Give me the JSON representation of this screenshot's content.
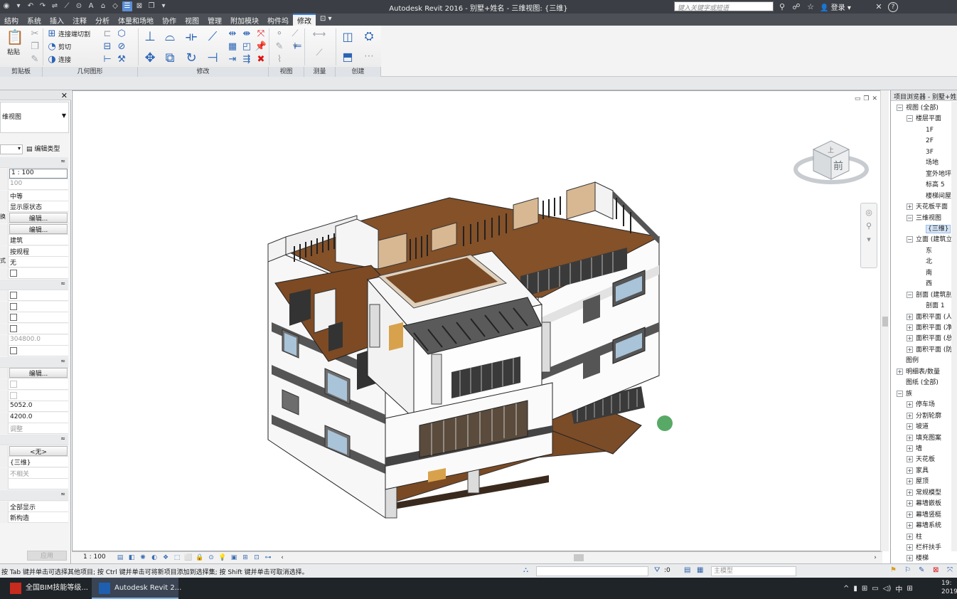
{
  "app": {
    "title": "Autodesk Revit 2016 -     别墅+姓名 - 三维视图: {三维}",
    "search_placeholder": "键入关键字或短语",
    "login": "登录",
    "help": "?"
  },
  "tabs": [
    "结构",
    "系统",
    "插入",
    "注释",
    "分析",
    "体量和场地",
    "协作",
    "视图",
    "管理",
    "附加模块",
    "构件坞",
    "修改"
  ],
  "ribbon": {
    "paste": "粘贴",
    "connect_cut": "连接端切割",
    "cut": "剪切",
    "join": "连接",
    "panels": [
      "剪贴板",
      "几何图形",
      "修改",
      "视图",
      "测量",
      "创建"
    ]
  },
  "properties": {
    "type_name": "维视图",
    "edit_type": "编辑类型",
    "rows": [
      {
        "kind": "section",
        "v": "≈"
      },
      {
        "kind": "boxed",
        "v": "1 : 100"
      },
      {
        "kind": "text",
        "v": "100",
        "dim": true
      },
      {
        "kind": "text",
        "v": "中等"
      },
      {
        "kind": "text",
        "v": "显示原状态"
      },
      {
        "kind": "btn",
        "l": "换",
        "v": "编辑..."
      },
      {
        "kind": "btn",
        "v": "编辑..."
      },
      {
        "kind": "text",
        "v": "建筑"
      },
      {
        "kind": "text",
        "v": "按规程"
      },
      {
        "kind": "text",
        "l": "式",
        "v": "无"
      },
      {
        "kind": "cb"
      },
      {
        "kind": "section",
        "v": "≈"
      },
      {
        "kind": "cb"
      },
      {
        "kind": "cb"
      },
      {
        "kind": "cb"
      },
      {
        "kind": "cb"
      },
      {
        "kind": "text",
        "v": "304800.0",
        "dim": true
      },
      {
        "kind": "cb"
      },
      {
        "kind": "section",
        "v": "≈"
      },
      {
        "kind": "btn",
        "v": "编辑..."
      },
      {
        "kind": "cb",
        "dim": true
      },
      {
        "kind": "cb",
        "dim": true
      },
      {
        "kind": "text",
        "v": "5052.0"
      },
      {
        "kind": "text",
        "v": "4200.0"
      },
      {
        "kind": "text",
        "v": "调整",
        "dim": true
      },
      {
        "kind": "section",
        "v": "≈"
      },
      {
        "kind": "btn",
        "v": "<无>"
      },
      {
        "kind": "text",
        "v": "{三维}"
      },
      {
        "kind": "text",
        "v": "不相关",
        "dim": true
      },
      {
        "kind": "text",
        "v": ""
      },
      {
        "kind": "section",
        "v": "≈"
      },
      {
        "kind": "text",
        "v": "全部显示"
      },
      {
        "kind": "text",
        "v": "新构造"
      }
    ],
    "apply": "应用"
  },
  "viewcube": {
    "face": "前",
    "top": "上"
  },
  "viewbar": {
    "scale": "1 : 100"
  },
  "browser": {
    "title": "项目浏览器 - 别墅+姓",
    "items": [
      {
        "d": 0,
        "t": "视图 (全部)",
        "tg": "−"
      },
      {
        "d": 1,
        "t": "楼层平面",
        "tg": "−"
      },
      {
        "d": 2,
        "t": "1F"
      },
      {
        "d": 2,
        "t": "2F"
      },
      {
        "d": 2,
        "t": "3F"
      },
      {
        "d": 2,
        "t": "场地"
      },
      {
        "d": 2,
        "t": "室外地坪"
      },
      {
        "d": 2,
        "t": "标高 5"
      },
      {
        "d": 2,
        "t": "楼梯间屋顶"
      },
      {
        "d": 1,
        "t": "天花板平面",
        "tg": "+"
      },
      {
        "d": 1,
        "t": "三维视图",
        "tg": "−"
      },
      {
        "d": 2,
        "t": "{三维}",
        "sel": true
      },
      {
        "d": 1,
        "t": "立面 (建筑立面)",
        "tg": "−"
      },
      {
        "d": 2,
        "t": "东"
      },
      {
        "d": 2,
        "t": "北"
      },
      {
        "d": 2,
        "t": "南"
      },
      {
        "d": 2,
        "t": "西"
      },
      {
        "d": 1,
        "t": "剖面 (建筑剖面)",
        "tg": "−"
      },
      {
        "d": 2,
        "t": "剖面 1"
      },
      {
        "d": 1,
        "t": "面积平面 (人防分区)",
        "tg": "+"
      },
      {
        "d": 1,
        "t": "面积平面 (净面积)",
        "tg": "+"
      },
      {
        "d": 1,
        "t": "面积平面 (总建筑面积)",
        "tg": "+"
      },
      {
        "d": 1,
        "t": "面积平面 (防火分区)",
        "tg": "+"
      },
      {
        "d": 0,
        "t": "图例"
      },
      {
        "d": 0,
        "t": "明细表/数量",
        "tg": "+"
      },
      {
        "d": 0,
        "t": "图纸 (全部)"
      },
      {
        "d": 0,
        "t": "族",
        "tg": "−"
      },
      {
        "d": 1,
        "t": "停车场",
        "tg": "+"
      },
      {
        "d": 1,
        "t": "分割轮廓",
        "tg": "+"
      },
      {
        "d": 1,
        "t": "坡道",
        "tg": "+"
      },
      {
        "d": 1,
        "t": "填充图案",
        "tg": "+"
      },
      {
        "d": 1,
        "t": "墙",
        "tg": "+"
      },
      {
        "d": 1,
        "t": "天花板",
        "tg": "+"
      },
      {
        "d": 1,
        "t": "家具",
        "tg": "+"
      },
      {
        "d": 1,
        "t": "屋顶",
        "tg": "+"
      },
      {
        "d": 1,
        "t": "常规模型",
        "tg": "+"
      },
      {
        "d": 1,
        "t": "幕墙嵌板",
        "tg": "+"
      },
      {
        "d": 1,
        "t": "幕墙竖梃",
        "tg": "+"
      },
      {
        "d": 1,
        "t": "幕墙系统",
        "tg": "+"
      },
      {
        "d": 1,
        "t": "柱",
        "tg": "+"
      },
      {
        "d": 1,
        "t": "栏杆扶手",
        "tg": "+"
      },
      {
        "d": 1,
        "t": "楼梯",
        "tg": "+"
      }
    ]
  },
  "status": {
    "message": "按 Tab 键并单击可选择其他项目; 按 Ctrl 键并单击可将新项目添加到选择集; 按 Shift 键并单击可取消选择。",
    "count": ":0",
    "model": "主模型"
  },
  "taskbar": {
    "items": [
      "全国BIM技能等级...",
      "Autodesk Revit 2..."
    ],
    "ime": "中",
    "time": "19:",
    "date": "2019"
  },
  "colors": {
    "titlebar": "#3b3f45",
    "tabbar": "#4d5157",
    "floor": "#7a4a24",
    "accent": "#3d7fd6"
  }
}
